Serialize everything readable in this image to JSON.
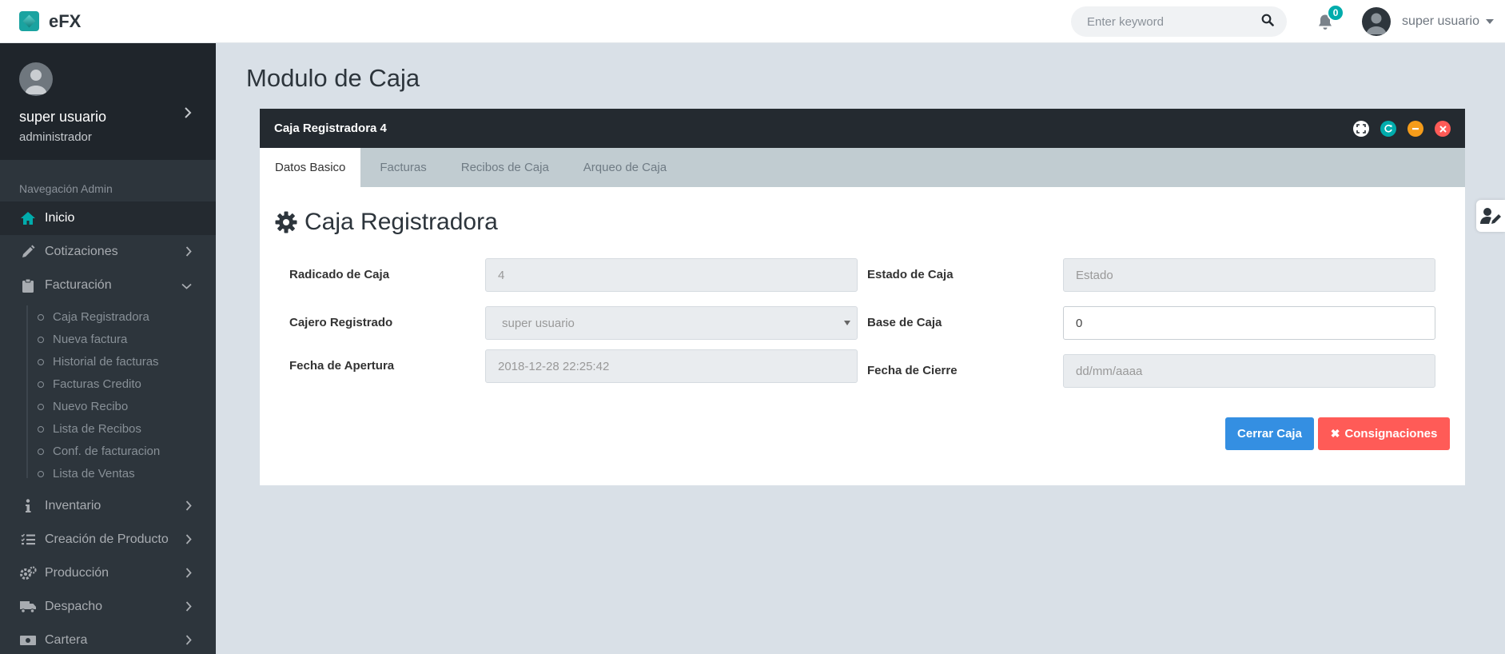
{
  "header": {
    "brand": "eFX",
    "search_placeholder": "Enter keyword",
    "notification_count": "0",
    "user_name": "super usuario"
  },
  "sidebar": {
    "profile": {
      "name": "super usuario",
      "role": "administrador"
    },
    "nav_header": "Navegación Admin",
    "items": [
      {
        "label": "Inicio",
        "icon": "home-icon",
        "active": true
      },
      {
        "label": "Cotizaciones",
        "icon": "pencil-icon"
      },
      {
        "label": "Facturación",
        "icon": "clipboard-icon",
        "expanded": true
      },
      {
        "label": "Inventario",
        "icon": "info-icon"
      },
      {
        "label": "Creación de Producto",
        "icon": "list-icon"
      },
      {
        "label": "Producción",
        "icon": "cogs-icon"
      },
      {
        "label": "Despacho",
        "icon": "truck-icon"
      },
      {
        "label": "Cartera",
        "icon": "money-icon"
      }
    ],
    "facturacion_sub": [
      "Caja Registradora",
      "Nueva factura",
      "Historial de facturas",
      "Facturas Credito",
      "Nuevo Recibo",
      "Lista de Recibos",
      "Conf. de facturacion",
      "Lista de Ventas"
    ]
  },
  "main": {
    "page_title": "Modulo de Caja",
    "panel": {
      "title": "Caja Registradora 4",
      "tabs": [
        "Datos Basico",
        "Facturas",
        "Recibos de Caja",
        "Arqueo de Caja"
      ],
      "section_title": "Caja Registradora",
      "form": {
        "radicado_label": "Radicado de Caja",
        "radicado_value": "4",
        "estado_label": "Estado de Caja",
        "estado_placeholder": "Estado",
        "cajero_label": "Cajero Registrado",
        "cajero_value": "super usuario",
        "base_label": "Base de Caja",
        "base_value": "0",
        "apertura_label": "Fecha de Apertura",
        "apertura_value": "2018-12-28 22:25:42",
        "cierre_label": "Fecha de Cierre",
        "cierre_placeholder": "dd/mm/aaaa"
      },
      "buttons": {
        "close": "Cerrar Caja",
        "consignaciones": "Consignaciones"
      }
    }
  },
  "colors": {
    "sidebar_bg": "#2d353c",
    "accent_teal": "#00acac",
    "primary_blue": "#348fe2",
    "danger_red": "#ff5b57",
    "warning_orange": "#f59c1a"
  }
}
